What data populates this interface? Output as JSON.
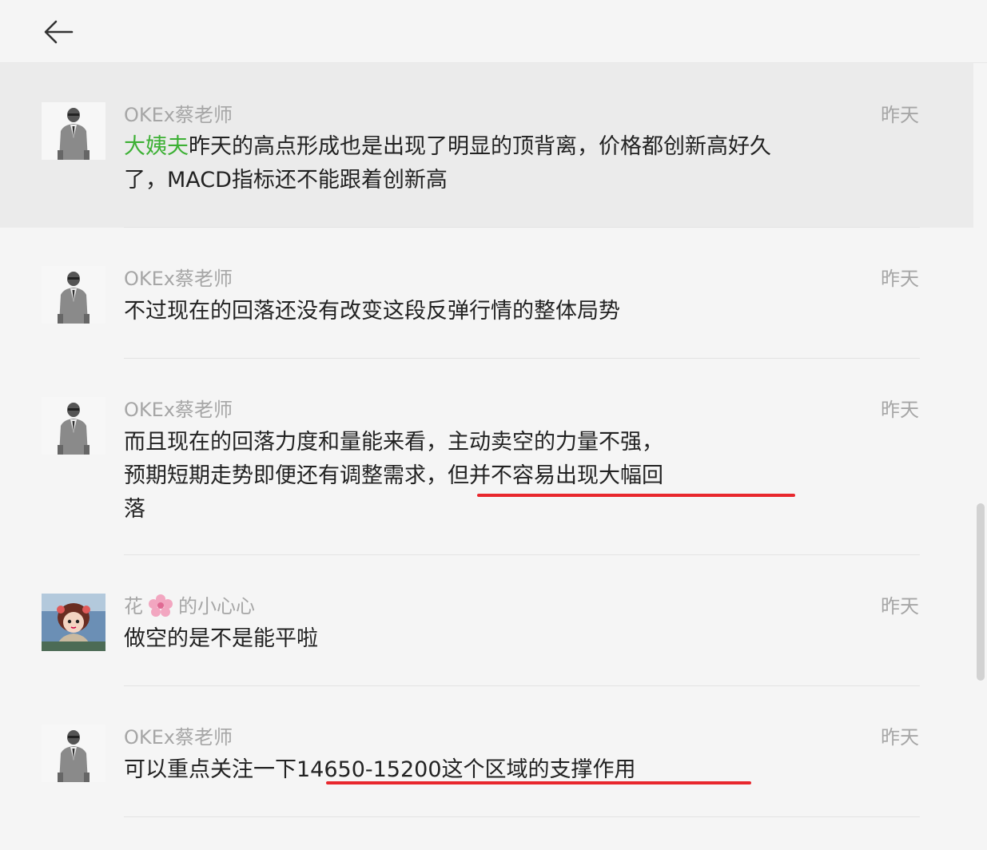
{
  "header": {
    "back_icon": "arrow-left-icon"
  },
  "messages": [
    {
      "author": "OKEx蔡老师",
      "time": "昨天",
      "mention": "大姨夫",
      "text": "昨天的高点形成也是出现了明显的顶背离，价格都创新高好久了，MACD指标还不能跟着创新高"
    },
    {
      "author": "OKEx蔡老师",
      "time": "昨天",
      "text": "不过现在的回落还没有改变这段反弹行情的整体局势"
    },
    {
      "author": "OKEx蔡老师",
      "time": "昨天",
      "text_line1": "而且现在的回落力度和量能来看，主动卖空的力量不强，",
      "text_line2": "预期短期走势即便还有调整需求，但并不容易出现大幅回",
      "text_line3": "落"
    },
    {
      "author_part1": "花",
      "author_part2": "的小心心",
      "time": "昨天",
      "text": "做空的是不是能平啦"
    },
    {
      "author": "OKEx蔡老师",
      "time": "昨天",
      "text": "可以重点关注一下14650-15200这个区域的支撑作用"
    }
  ],
  "colors": {
    "mention": "#3cb034",
    "underline": "#e8272d",
    "highlight_bg": "#ebebeb"
  }
}
